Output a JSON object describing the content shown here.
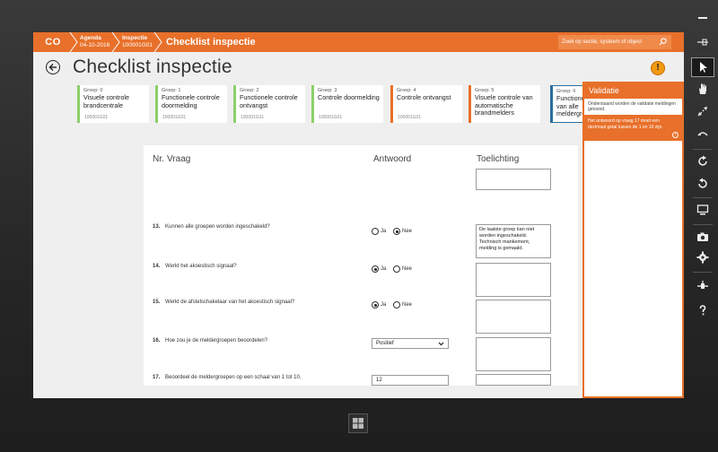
{
  "topbar": {
    "logo": "CO",
    "crumbs": [
      {
        "title": "Agenda",
        "sub": "04-10-2016"
      },
      {
        "title": "Inspectie",
        "sub": "100001G01"
      }
    ],
    "title": "Checklist inspectie",
    "search_placeholder": "Zoek op sectie, systeem of object"
  },
  "page": {
    "title": "Checklist inspectie",
    "warning_badge": "!"
  },
  "groups": [
    {
      "group": "Groep: 0",
      "name": "Visuele controle brandcentrale",
      "code": "100001G01",
      "status": "green"
    },
    {
      "group": "Groep: 1",
      "name": "Functionele controle doormelding",
      "code": "100001G01",
      "status": "green"
    },
    {
      "group": "Groep: 2",
      "name": "Functionele controle ontvangst",
      "code": "100001G01",
      "status": "green"
    },
    {
      "group": "Groep: 3",
      "name": "Controle doormelding",
      "code": "100001G01",
      "status": "green"
    },
    {
      "group": "Groep: 4",
      "name": "Controle ontvangst",
      "code": "100001G01",
      "status": "orange"
    },
    {
      "group": "Groep: 5",
      "name": "Visuele controle van automatische brandmelders",
      "code": "",
      "status": "orange"
    },
    {
      "group": "Groep: 6",
      "name": "Functionele van alle meldergro",
      "code": "",
      "status": "selected"
    }
  ],
  "checklist": {
    "headers": {
      "nr": "Nr.",
      "vraag": "Vraag",
      "antwoord": "Antwoord",
      "toelichting": "Toelichting"
    },
    "questions": [
      {
        "nr": "13.",
        "text": "Kunnen alle groepen worden ingeschakeld?",
        "type": "radio",
        "options": [
          "Ja",
          "Nee"
        ],
        "selected": "Nee",
        "note": "De laatste groep kan niet worden ingeschakeld. Technisch mankement, melding is gemaakt."
      },
      {
        "nr": "14.",
        "text": "Werkt het akoestisch signaal?",
        "type": "radio",
        "options": [
          "Ja",
          "Nee"
        ],
        "selected": "Ja",
        "note": ""
      },
      {
        "nr": "15.",
        "text": "Werkt de afstelschakelaar van het akoestisch signaal?",
        "type": "radio",
        "options": [
          "Ja",
          "Nee"
        ],
        "selected": "Ja",
        "note": ""
      },
      {
        "nr": "16.",
        "text": "Hoe zou je de meldergroepen beoordelen?",
        "type": "select",
        "value": "Positief",
        "note": ""
      },
      {
        "nr": "17.",
        "text": "Beoordeel de meldergroepen op een schaal van 1 tot 10.",
        "type": "number",
        "value": "12",
        "note": ""
      }
    ]
  },
  "validation": {
    "title": "Validatie",
    "subtitle": "Onderstaand worden de validatie meldingen getoond.",
    "messages": [
      "Het antwoord op vraag 17 moet een decimaal getal tussen de 1 en 10 zijn."
    ],
    "info_icon": "i"
  },
  "sidetools": [
    "minimize-icon",
    "pin-icon",
    "cursor-icon",
    "hand-icon",
    "resize-icon",
    "swipe-icon",
    "rotate-right-icon",
    "rotate-left-icon",
    "display-icon",
    "camera-icon",
    "settings-icon",
    "connect-icon",
    "help-icon"
  ],
  "colors": {
    "accent": "#e8702a",
    "green": "#8bd06a",
    "selected": "#2c6ea1"
  }
}
